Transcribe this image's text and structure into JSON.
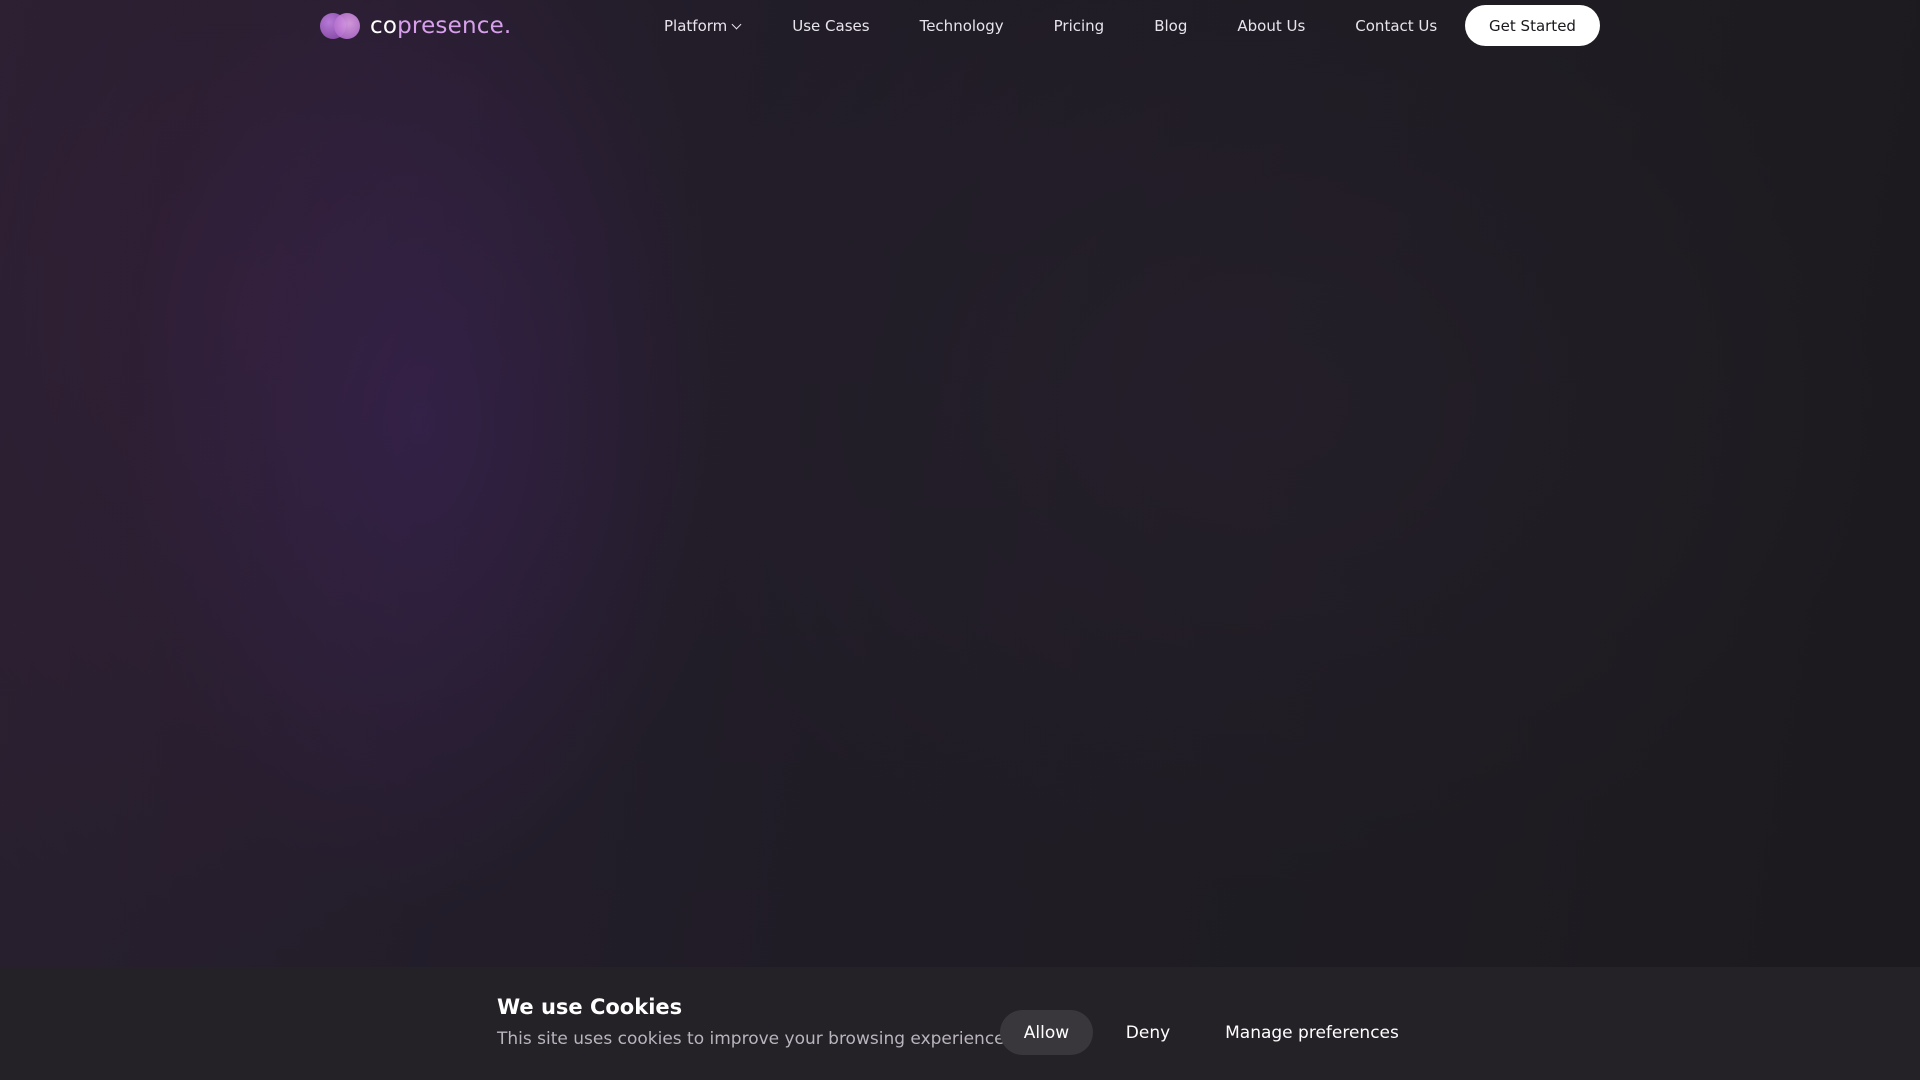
{
  "brand": {
    "name_prefix": "co",
    "name_rest": "presence.",
    "accent_color": "#d8a0ec",
    "logo_icon": "overlapping-circles-logo-icon"
  },
  "nav": {
    "items": [
      {
        "label": "Platform",
        "has_dropdown": true
      },
      {
        "label": "Use Cases"
      },
      {
        "label": "Technology"
      },
      {
        "label": "Pricing"
      },
      {
        "label": "Blog"
      },
      {
        "label": "About Us"
      },
      {
        "label": "Contact Us"
      }
    ],
    "cta_label": "Get Started"
  },
  "cookie_banner": {
    "title": "We use Cookies",
    "message": "This site uses cookies to improve your browsing experience.",
    "allow_label": "Allow",
    "deny_label": "Deny",
    "manage_label": "Manage preferences"
  }
}
